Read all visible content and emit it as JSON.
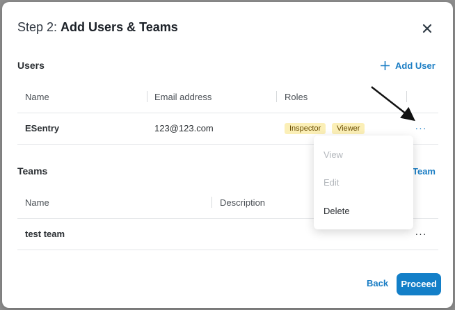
{
  "dialog": {
    "title_prefix": "Step 2: ",
    "title_main": "Add Users & Teams",
    "close_icon": "close-icon"
  },
  "users": {
    "section_title": "Users",
    "add_label": "Add User",
    "columns": [
      "Name",
      "Email address",
      "Roles"
    ],
    "rows": [
      {
        "name": "ESentry",
        "email": "123@123.com",
        "roles": [
          "Inspector",
          "Viewer"
        ]
      }
    ],
    "row_menu": {
      "items": [
        {
          "label": "View",
          "enabled": false
        },
        {
          "label": "Edit",
          "enabled": false
        },
        {
          "label": "Delete",
          "enabled": true
        }
      ]
    }
  },
  "teams": {
    "section_title": "Teams",
    "add_label_visible": "Team",
    "columns": [
      "Name",
      "Description"
    ],
    "rows": [
      {
        "name": "test team",
        "description": ""
      }
    ]
  },
  "footer": {
    "back_label": "Back",
    "proceed_label": "Proceed"
  },
  "colors": {
    "accent": "#137fc8",
    "link": "#1a7dc4",
    "tag_bg": "#fbefb7"
  }
}
